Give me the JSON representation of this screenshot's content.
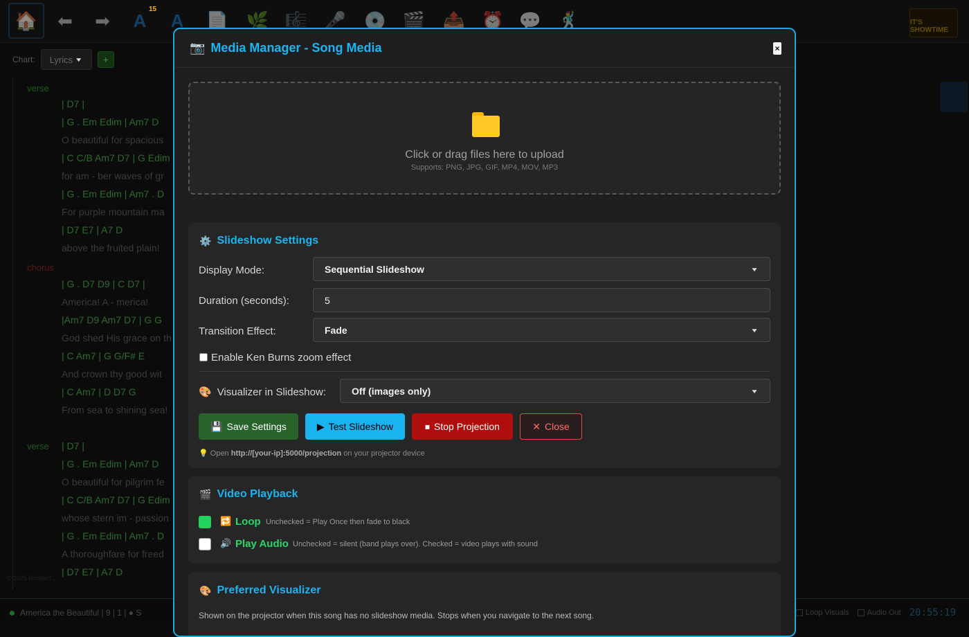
{
  "toolbar": {
    "badge_count": "15",
    "showtime_label": "IT'S SHOWTIME"
  },
  "chart_selector": {
    "label": "Chart:",
    "value": "Lyrics",
    "add_label": "+"
  },
  "lyrics": {
    "sections": [
      {
        "label": "verse",
        "color": "#1e5a1e"
      },
      {
        "label": "chorus",
        "color": "#5a1a1a"
      },
      {
        "label": "verse",
        "color": "#1e5a1e"
      }
    ],
    "lines": [
      {
        "kind": "chord",
        "text": "|    D7    |"
      },
      {
        "kind": "chord",
        "text": "| G . Em Edim | Am7  D"
      },
      {
        "kind": "lyric",
        "text": "O beautiful for spacious"
      },
      {
        "kind": "chord",
        "text": "| C  C/B Am7 D7 | G Edim"
      },
      {
        "kind": "lyric",
        "text": "for am - ber waves of gr"
      },
      {
        "kind": "chord",
        "text": "|  G . Em  Edim | Am7 . D"
      },
      {
        "kind": "lyric",
        "text": "For purple mountain ma"
      },
      {
        "kind": "chord",
        "text": "|   D7    E7    |  A7    D"
      },
      {
        "kind": "lyric",
        "text": "above the fruited plain!"
      },
      {
        "kind": "chord",
        "text": "| G . D7 D9  | C    D7  |"
      },
      {
        "kind": "lyric",
        "text": "America! A - merica!"
      },
      {
        "kind": "chord",
        "text": "|Am7  D9  Am7  D7 | G  G"
      },
      {
        "kind": "lyric",
        "text": "God shed His grace on th"
      },
      {
        "kind": "chord",
        "text": "| C       Am7 |   G  G/F#  E"
      },
      {
        "kind": "lyric",
        "text": "And crown thy good wit"
      },
      {
        "kind": "chord",
        "text": "| C       Am7 | D   D7  G"
      },
      {
        "kind": "lyric",
        "text": "From sea to shining sea!"
      },
      {
        "kind": "chord",
        "text": "|    D7      |"
      },
      {
        "kind": "chord",
        "text": "| G . Em  Edim | Am7  D"
      },
      {
        "kind": "lyric",
        "text": "O beautiful for pilgrim fe"
      },
      {
        "kind": "chord",
        "text": "| C  C/B Am7 D7 | G Edim"
      },
      {
        "kind": "lyric",
        "text": "whose stern im - passion"
      },
      {
        "kind": "chord",
        "text": "|  G . Em  Edim | Am7 . D"
      },
      {
        "kind": "lyric",
        "text": "A thoroughfare for freed"
      },
      {
        "kind": "chord",
        "text": "|   D7    E7    |  A7    D"
      }
    ],
    "copyright": "© 2025 Robbert ..."
  },
  "status": {
    "song_info": "America the Beautiful |  9  |  1 | ● S",
    "loop_visuals": "Loop Visuals",
    "audio_out": "Audio Out",
    "clock": "20:55:19"
  },
  "modal": {
    "title": "Media Manager - Song Media",
    "close_x": "×",
    "dropzone": {
      "main_text": "Click or drag files here to upload",
      "sub_text": "Supports: PNG, JPG, GIF, MP4, MOV, MP3"
    },
    "slideshow": {
      "title": "Slideshow Settings",
      "display_mode_label": "Display Mode:",
      "display_mode_value": "Sequential Slideshow",
      "duration_label": "Duration (seconds):",
      "duration_value": "5",
      "transition_label": "Transition Effect:",
      "transition_value": "Fade",
      "ken_burns_label": "Enable Ken Burns zoom effect",
      "visualizer_label": "Visualizer in Slideshow:",
      "visualizer_value": "Off (images only)",
      "save_label": "Save Settings",
      "test_label": "Test Slideshow",
      "stop_label": "Stop Projection",
      "close_label": "Close",
      "hint_prefix": "Open ",
      "hint_url": "http://[your-ip]:5000/projection",
      "hint_suffix": " on your projector device"
    },
    "video": {
      "title": "Video Playback",
      "loop_label": "Loop",
      "loop_desc": "Unchecked = Play Once then fade to black",
      "audio_label": "Play Audio",
      "audio_desc": "Unchecked = silent (band plays over). Checked = video plays with sound"
    },
    "visualizer": {
      "title": "Preferred Visualizer",
      "desc": "Shown on the projector when this song has no slideshow media. Stops when you navigate to the next song."
    }
  }
}
